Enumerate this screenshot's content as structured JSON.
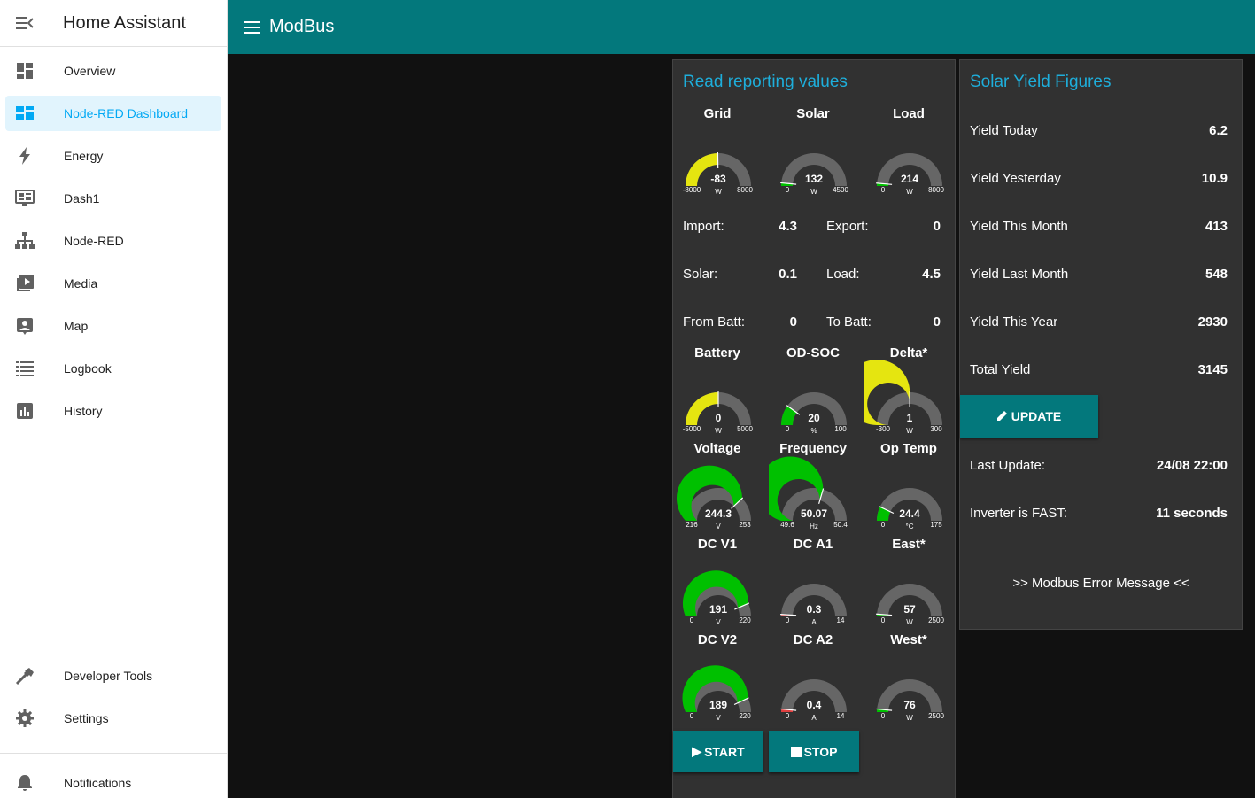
{
  "sidebar": {
    "title": "Home Assistant",
    "items": [
      {
        "label": "Overview",
        "icon": "dashboard-icon"
      },
      {
        "label": "Node-RED Dashboard",
        "icon": "node-red-dashboard-icon"
      },
      {
        "label": "Energy",
        "icon": "lightning-icon"
      },
      {
        "label": "Dash1",
        "icon": "monitor-dashboard-icon"
      },
      {
        "label": "Node-RED",
        "icon": "sitemap-icon"
      },
      {
        "label": "Media",
        "icon": "play-box-multiple-icon"
      },
      {
        "label": "Map",
        "icon": "account-box-icon"
      },
      {
        "label": "Logbook",
        "icon": "format-list-icon"
      },
      {
        "label": "History",
        "icon": "chart-box-icon"
      }
    ],
    "developer_tools": "Developer Tools",
    "settings": "Settings",
    "notifications": "Notifications"
  },
  "header": {
    "title": "ModBus"
  },
  "reporting": {
    "title": "Read reporting values",
    "gauges": [
      {
        "label": "Grid",
        "value": "-83",
        "unit": "W",
        "min": "-8000",
        "max": "8000",
        "fraction": 0.495,
        "color": "#e5e510"
      },
      {
        "label": "Solar",
        "value": "132",
        "unit": "W",
        "min": "0",
        "max": "4500",
        "fraction": 0.03,
        "color": "#00c000"
      },
      {
        "label": "Load",
        "value": "214",
        "unit": "W",
        "min": "0",
        "max": "8000",
        "fraction": 0.027,
        "color": "#00c000"
      },
      {
        "label": "Battery",
        "value": "0",
        "unit": "W",
        "min": "-5000",
        "max": "5000",
        "fraction": 0.5,
        "color": "#e5e510"
      },
      {
        "label": "OD-SOC",
        "value": "20",
        "unit": "%",
        "min": "0",
        "max": "100",
        "fraction": 0.2,
        "color": "#00c000"
      },
      {
        "label": "Delta*",
        "value": "1",
        "unit": "W",
        "min": "-300",
        "max": "300",
        "fraction": 0.502,
        "color": "#e5e510"
      },
      {
        "label": "Voltage",
        "value": "244.3",
        "unit": "V",
        "min": "216",
        "max": "253",
        "fraction": 0.76,
        "color": "#00c000"
      },
      {
        "label": "Frequency",
        "value": "50.07",
        "unit": "Hz",
        "min": "49.6",
        "max": "50.4",
        "fraction": 0.59,
        "color": "#00c000"
      },
      {
        "label": "Op Temp",
        "value": "24.4",
        "unit": "°C",
        "min": "0",
        "max": "175",
        "fraction": 0.14,
        "color": "#00c000"
      },
      {
        "label": "DC V1",
        "value": "191",
        "unit": "V",
        "min": "0",
        "max": "220",
        "fraction": 0.87,
        "color": "#00c000"
      },
      {
        "label": "DC A1",
        "value": "0.3",
        "unit": "A",
        "min": "0",
        "max": "14",
        "fraction": 0.02,
        "color": "#e04040"
      },
      {
        "label": "East*",
        "value": "57",
        "unit": "W",
        "min": "0",
        "max": "2500",
        "fraction": 0.023,
        "color": "#00c000"
      },
      {
        "label": "DC V2",
        "value": "189",
        "unit": "V",
        "min": "0",
        "max": "220",
        "fraction": 0.86,
        "color": "#00c000"
      },
      {
        "label": "DC A2",
        "value": "0.4",
        "unit": "A",
        "min": "0",
        "max": "14",
        "fraction": 0.03,
        "color": "#e04040"
      },
      {
        "label": "West*",
        "value": "76",
        "unit": "W",
        "min": "0",
        "max": "2500",
        "fraction": 0.03,
        "color": "#00c000"
      }
    ],
    "import_label": "Import:",
    "import_value": "4.3",
    "export_label": "Export:",
    "export_value": "0",
    "solar_label": "Solar:",
    "solar_value": "0.1",
    "load_label": "Load:",
    "load_value": "4.5",
    "from_batt_label": "From Batt:",
    "from_batt_value": "0",
    "to_batt_label": "To Batt:",
    "to_batt_value": "0",
    "start_label": "START",
    "stop_label": "STOP"
  },
  "yield": {
    "title": "Solar Yield Figures",
    "rows": [
      {
        "label": "Yield Today",
        "value": "6.2"
      },
      {
        "label": "Yield Yesterday",
        "value": "10.9"
      },
      {
        "label": "Yield This Month",
        "value": "413"
      },
      {
        "label": "Yield Last Month",
        "value": "548"
      },
      {
        "label": "Yield This Year",
        "value": "2930"
      },
      {
        "label": "Total Yield",
        "value": "3145"
      }
    ],
    "update_label": "UPDATE",
    "last_update_label": "Last Update:",
    "last_update_value": "24/08 22:00",
    "inverter_label": "Inverter is FAST:",
    "inverter_value": "11 seconds",
    "error_message": ">> Modbus Error Message <<"
  },
  "colors": {
    "accent": "#03787c",
    "title_blue": "#1eaedb",
    "active_bg": "#e1f4fd",
    "active_fg": "#03a9f4"
  }
}
